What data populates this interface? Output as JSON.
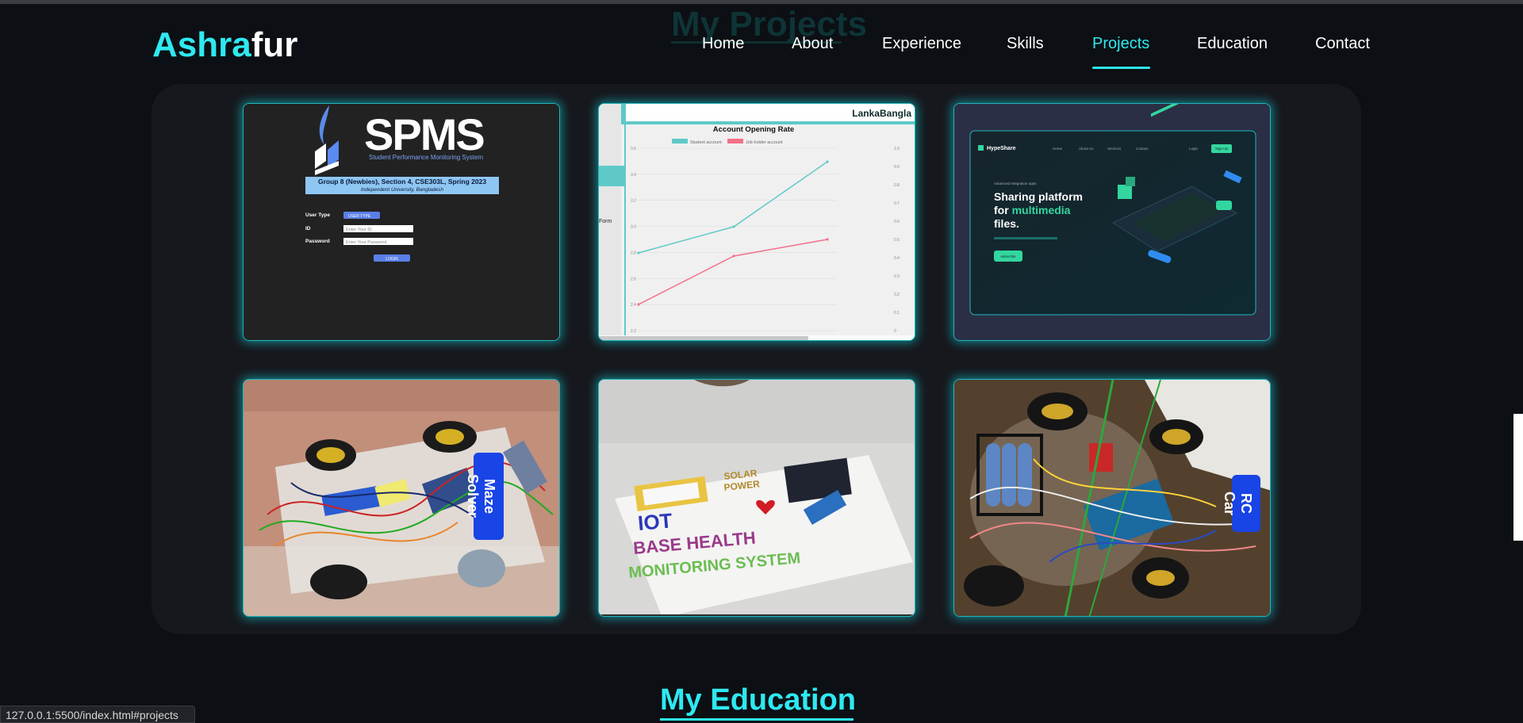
{
  "background_title": "My Projects",
  "logo": {
    "part1": "Ashra",
    "part2": "fur"
  },
  "nav": [
    {
      "label": "Home"
    },
    {
      "label": "About"
    },
    {
      "label": "Experience"
    },
    {
      "label": "Skills"
    },
    {
      "label": "Projects"
    },
    {
      "label": "Education"
    },
    {
      "label": "Contact"
    }
  ],
  "active_nav": "Projects",
  "projects": [
    {
      "name": "spms",
      "logo_text": "SPMS",
      "subtitle": "Student Performance Monitoring System",
      "banner_line1": "Group 8 (Newbies), Section 4, CSE303L, Spring 2023",
      "banner_line2": "Independent University, Bangladesh",
      "user_type_label": "User Type",
      "user_type_value": "USER TYPE",
      "id_label": "ID",
      "id_placeholder": "Enter Your ID",
      "password_label": "Password",
      "password_placeholder": "Enter Your Password",
      "login_label": "LOGIN"
    },
    {
      "name": "lankabangla",
      "brand": "LankaBangla",
      "side_label": "Form",
      "chart_title": "Account Opening Rate",
      "legend": [
        "Student account",
        "Job holder account"
      ],
      "y_left_ticks": [
        "3.6",
        "3.4",
        "3.2",
        "3.0",
        "2.8",
        "2.6",
        "2.4",
        "2.2"
      ],
      "y_right_ticks": [
        "1.0",
        "0.9",
        "0.8",
        "0.7",
        "0.6",
        "0.5",
        "0.4",
        "0.3",
        "0.2",
        "0.1",
        "0"
      ]
    },
    {
      "name": "hypeshare",
      "brand": "HypeShare",
      "menu": [
        "Home",
        "About Us",
        "Services",
        "Contact"
      ],
      "login": "Login",
      "signup": "Sign Up",
      "small_caption": "Advanced Integration apps",
      "headline_1": "Sharing platform",
      "headline_2a": "for ",
      "headline_2b": "multimedia",
      "headline_3": "files.",
      "cta": "subscribe"
    },
    {
      "name": "maze-solver",
      "tag": "Maze Solver"
    },
    {
      "name": "iot-health",
      "poster_line0": "SOLAR",
      "poster_line0b": "POWER",
      "poster_line1": "IOT",
      "poster_line2": "BASE HEALTH",
      "poster_line3": "MONITORING SYSTEM"
    },
    {
      "name": "rc-car",
      "tag": "RC Car"
    }
  ],
  "education_title": "My Education",
  "status_url": "127.0.0.1:5500/index.html#projects",
  "colors": {
    "accent": "#2ee9f1",
    "tag": "#1944e6",
    "panel": "#16181d",
    "page": "#0c0f13"
  }
}
